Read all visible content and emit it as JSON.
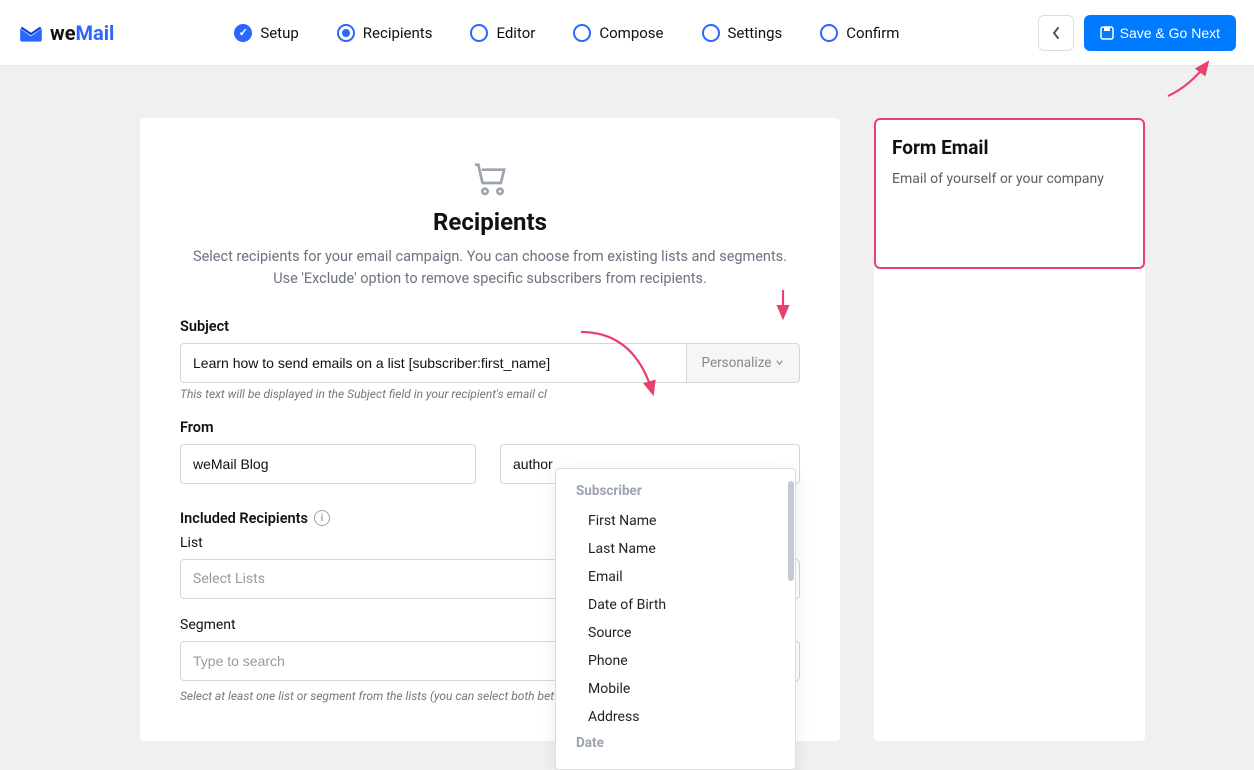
{
  "logo": {
    "text1": "we",
    "text2": "Mail"
  },
  "steps": [
    {
      "label": "Setup",
      "state": "done"
    },
    {
      "label": "Recipients",
      "state": "active"
    },
    {
      "label": "Editor",
      "state": "pending"
    },
    {
      "label": "Compose",
      "state": "pending"
    },
    {
      "label": "Settings",
      "state": "pending"
    },
    {
      "label": "Confirm",
      "state": "pending"
    }
  ],
  "header": {
    "save_label": "Save & Go Next"
  },
  "main": {
    "title": "Recipients",
    "subtitle": "Select recipients for your email campaign. You can choose from existing lists and segments. Use 'Exclude' option to remove specific subscribers from recipients.",
    "subject_label": "Subject",
    "subject_value": "Learn how to send emails on a list [subscriber:first_name]",
    "personalize_label": "Personalize",
    "subject_help": "This text will be displayed in the Subject field in your recipient's email cl",
    "from_label": "From",
    "from_name": "weMail Blog",
    "from_email": "author",
    "included_label": "Included Recipients",
    "list_label": "List",
    "list_placeholder": "Select Lists",
    "segment_label": "Segment",
    "segment_placeholder": "Type to search",
    "footer_help": "Select at least one list or segment from the lists (you can select both between list and segment)."
  },
  "dropdown": {
    "group1": "Subscriber",
    "items1": [
      "First Name",
      "Last Name",
      "Email",
      "Date of Birth",
      "Source",
      "Phone",
      "Mobile",
      "Address"
    ],
    "group2": "Date"
  },
  "side": {
    "title": "Form Email",
    "text": "Email of yourself or your company"
  }
}
